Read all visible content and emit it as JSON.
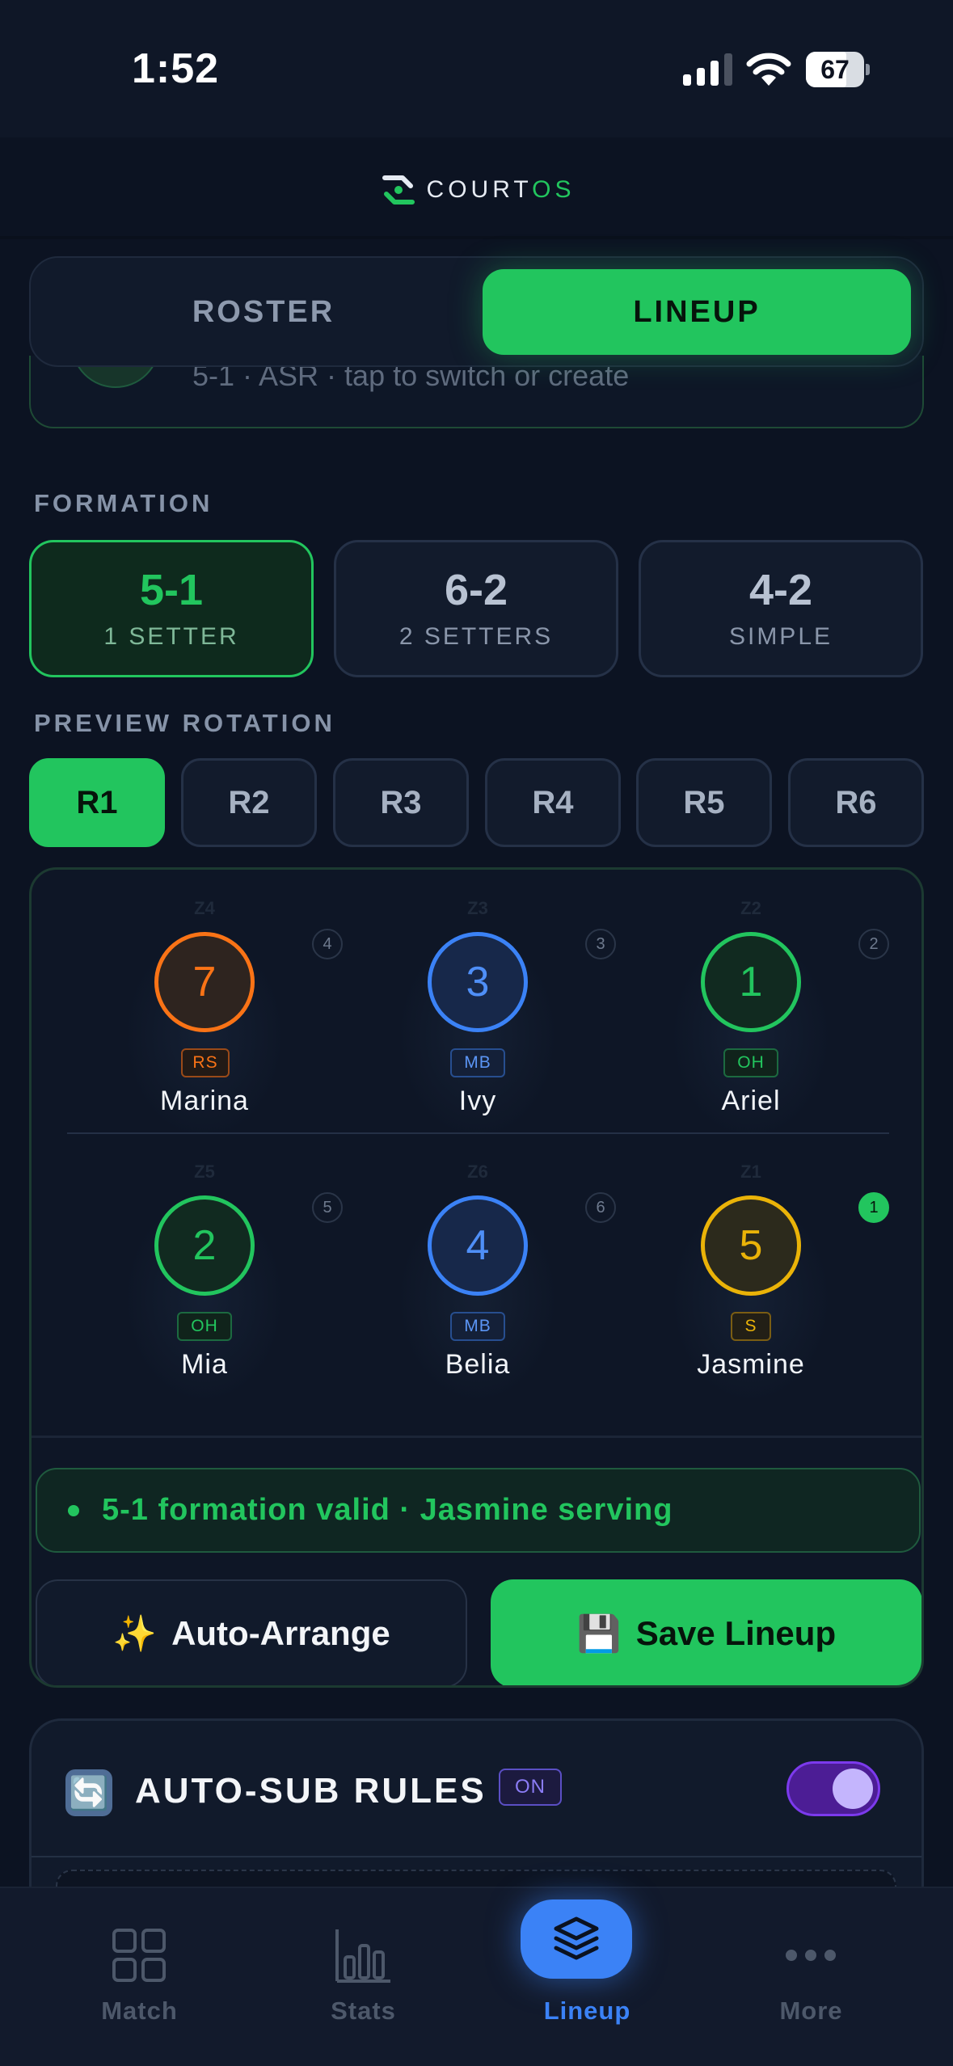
{
  "status_bar": {
    "time": "1:52",
    "battery_level": "67"
  },
  "header": {
    "brand_main": "COURT",
    "brand_accent": "OS"
  },
  "segmented_tabs": {
    "roster": "ROSTER",
    "lineup": "LINEUP",
    "active": "lineup"
  },
  "saved_lineup": {
    "subtitle": "5-1 · ASR · tap to switch or create"
  },
  "formation": {
    "section_label": "FORMATION",
    "options": [
      {
        "title": "5-1",
        "subtitle": "1 SETTER",
        "active": true
      },
      {
        "title": "6-2",
        "subtitle": "2 SETTERS",
        "active": false
      },
      {
        "title": "4-2",
        "subtitle": "SIMPLE",
        "active": false
      }
    ]
  },
  "rotation": {
    "section_label": "PREVIEW ROTATION",
    "tabs": [
      "R1",
      "R2",
      "R3",
      "R4",
      "R5",
      "R6"
    ],
    "active": "R1"
  },
  "court": {
    "players": [
      {
        "zone": "Z4",
        "position": "4",
        "number": "7",
        "role": "RS",
        "name": "Marina",
        "color": "#f97316"
      },
      {
        "zone": "Z3",
        "position": "3",
        "number": "3",
        "role": "MB",
        "name": "Ivy",
        "color": "#3b82f6"
      },
      {
        "zone": "Z2",
        "position": "2",
        "number": "1",
        "role": "OH",
        "name": "Ariel",
        "color": "#22c55e"
      },
      {
        "zone": "Z5",
        "position": "5",
        "number": "2",
        "role": "OH",
        "name": "Mia",
        "color": "#22c55e"
      },
      {
        "zone": "Z6",
        "position": "6",
        "number": "4",
        "role": "MB",
        "name": "Belia",
        "color": "#3b82f6"
      },
      {
        "zone": "Z1",
        "position": "1",
        "number": "5",
        "role": "S",
        "name": "Jasmine",
        "color": "#eab308",
        "serving": true
      }
    ],
    "status_text": "5-1 formation valid · Jasmine serving",
    "auto_arrange_label": "Auto-Arrange",
    "auto_arrange_icon": "✨",
    "save_label": "Save Lineup",
    "save_icon": "💾"
  },
  "auto_sub": {
    "icon": "🔄",
    "title": "AUTO-SUB RULES",
    "badge": "ON",
    "enabled": true
  },
  "bottom_nav": {
    "items": [
      {
        "label": "Match",
        "icon": "grid-icon"
      },
      {
        "label": "Stats",
        "icon": "bar-chart-icon"
      },
      {
        "label": "Lineup",
        "icon": "layers-icon",
        "active": true
      },
      {
        "label": "More",
        "icon": "more-dots-icon"
      }
    ]
  },
  "colors": {
    "accent_green": "#22c55e",
    "accent_blue": "#3b82f6",
    "accent_purple": "#7c3aed",
    "background": "#0c1322"
  }
}
